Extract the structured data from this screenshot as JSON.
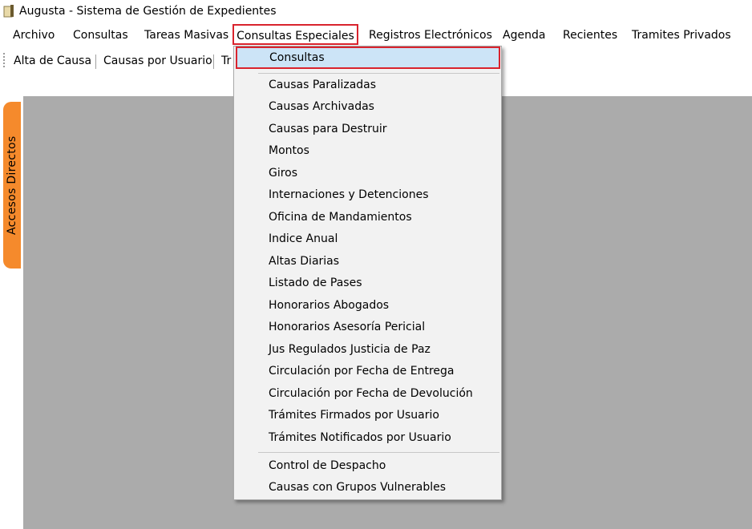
{
  "window": {
    "title": "Augusta - Sistema de Gestión de Expedientes"
  },
  "menubar": {
    "items": [
      "Archivo",
      "Consultas",
      "Tareas Masivas",
      "Consultas Especiales",
      "Registros Electrónicos",
      "Agenda",
      "Recientes",
      "Tramites Privados"
    ]
  },
  "toolbar": {
    "items": [
      "Alta de Causa",
      "Causas por Usuario",
      "Tr"
    ]
  },
  "sidepanel": {
    "tab_label": "Accesos Directos"
  },
  "dropdown": {
    "highlighted": "Consultas",
    "group1": [
      "Causas Paralizadas",
      "Causas Archivadas",
      "Causas para Destruir",
      "Montos",
      "Giros",
      "Internaciones y Detenciones",
      "Oficina de Mandamientos",
      "Indice Anual",
      "Altas Diarias",
      "Listado de Pases",
      "Honorarios Abogados",
      "Honorarios Asesoría Pericial",
      "Jus Regulados Justicia de Paz",
      "Circulación por Fecha de Entrega",
      "Circulación por Fecha de Devolución",
      "Trámites Firmados por Usuario",
      "Trámites Notificados por Usuario"
    ],
    "group2": [
      "Control de Despacho",
      "Causas con Grupos Vulnerables"
    ]
  },
  "colors": {
    "highlight": "#cce4f7",
    "accent_box": "#d9232d",
    "side_tab": "#f58a2c",
    "workspace": "#ababab"
  }
}
